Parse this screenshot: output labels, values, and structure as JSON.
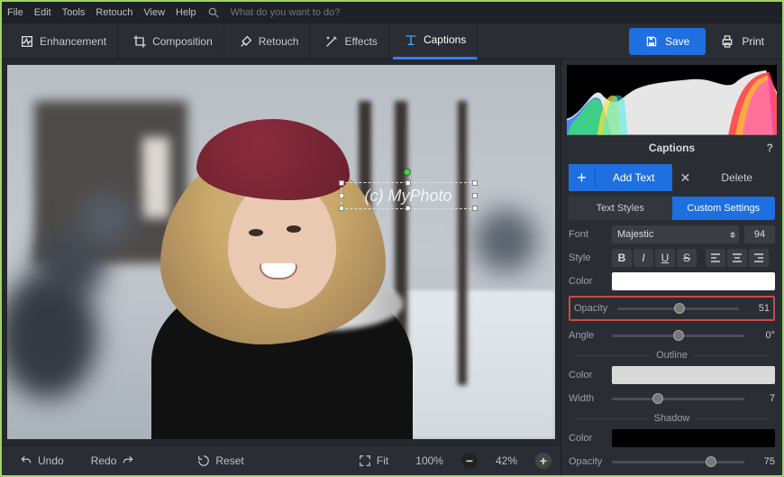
{
  "menu": {
    "items": [
      "File",
      "Edit",
      "Tools",
      "Retouch",
      "View",
      "Help"
    ],
    "search_placeholder": "What do you want to do?"
  },
  "toolbar": {
    "enhancement": "Enhancement",
    "composition": "Composition",
    "retouch": "Retouch",
    "effects": "Effects",
    "captions": "Captions",
    "save": "Save",
    "print": "Print"
  },
  "canvas": {
    "watermark_text": "(c) MyPhoto"
  },
  "bottom": {
    "undo": "Undo",
    "redo": "Redo",
    "reset": "Reset",
    "fit": "Fit",
    "zoom_100": "100%",
    "zoom_current": "42%"
  },
  "panel": {
    "title": "Captions",
    "add_text": "Add Text",
    "delete": "Delete",
    "subtab_styles": "Text Styles",
    "subtab_custom": "Custom Settings",
    "font_label": "Font",
    "font_value": "Majestic",
    "font_size": "94",
    "style_label": "Style",
    "color_label": "Color",
    "color_value": "#ffffff",
    "opacity_label": "Opacity",
    "opacity_value": "51",
    "angle_label": "Angle",
    "angle_value": "0°",
    "outline_head": "Outline",
    "outline_color": "#d9d9d9",
    "width_label": "Width",
    "width_value": "7",
    "shadow_head": "Shadow",
    "shadow_color": "#000000",
    "shadow_opacity_label": "Opacity",
    "shadow_opacity_value": "75"
  }
}
